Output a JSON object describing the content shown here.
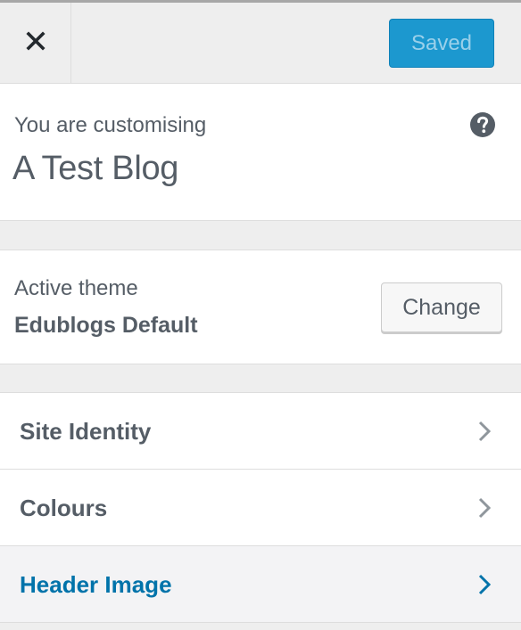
{
  "header": {
    "close_icon": "close-icon",
    "save_label": "Saved",
    "accent_color": "#1c98cf"
  },
  "info": {
    "label": "You are customising",
    "site_title": "A Test Blog",
    "help_icon": "help-icon"
  },
  "theme": {
    "label": "Active theme",
    "name": "Edublogs Default",
    "change_label": "Change"
  },
  "sections": [
    {
      "label": "Site Identity",
      "icon": "chevron-right-icon",
      "active": false
    },
    {
      "label": "Colours",
      "icon": "chevron-right-icon",
      "active": false
    },
    {
      "label": "Header Image",
      "icon": "chevron-right-icon",
      "active": true,
      "color": "#0073aa"
    }
  ]
}
